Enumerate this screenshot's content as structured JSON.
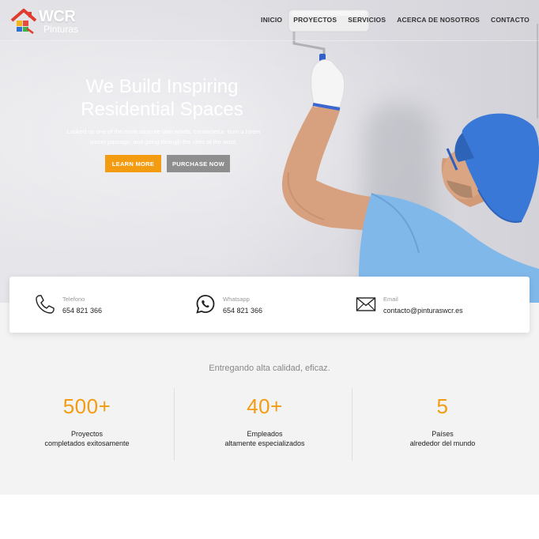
{
  "brand": {
    "name": "WCR",
    "subtitle": "Pinturas"
  },
  "nav": {
    "items": [
      {
        "label": "INICIO"
      },
      {
        "label": "PROYECTOS"
      },
      {
        "label": "SERVICIOS"
      },
      {
        "label": "ACERCA DE NOSOTROS"
      },
      {
        "label": "CONTACTO"
      }
    ]
  },
  "hero": {
    "title_line1": "We Build Inspiring",
    "title_line2": "Residential Spaces",
    "subtitle_line1": "Looked up one of the more obscure latin words, consectetur, from a lorem",
    "subtitle_line2": "ipsum passage, and going through the cites of the word.",
    "learn_more": "LEARN MORE",
    "purchase_now": "PURCHASE NOW"
  },
  "contact": {
    "phone": {
      "label": "Telefono",
      "value": "654 821 366",
      "icon": "phone-icon"
    },
    "whatsapp": {
      "label": "Whatsapp",
      "value": "654 821 366",
      "icon": "whatsapp-icon"
    },
    "email": {
      "label": "Email",
      "value": "contacto@pinturaswcr.es",
      "icon": "envelope-icon"
    }
  },
  "stats": {
    "tagline": "Entregando alta calidad, eficaz.",
    "items": [
      {
        "number": "500+",
        "line1": "Proyectos",
        "line2": "completados exitosamente"
      },
      {
        "number": "40+",
        "line1": "Empleados",
        "line2": "altamente especializados"
      },
      {
        "number": "5",
        "line1": "Países",
        "line2": "alrededor del mundo"
      }
    ]
  },
  "colors": {
    "accent": "#f39c12",
    "secondary_button": "#8e8e8e",
    "shirt": "#7fb6e8",
    "cap": "#3a78d8"
  }
}
